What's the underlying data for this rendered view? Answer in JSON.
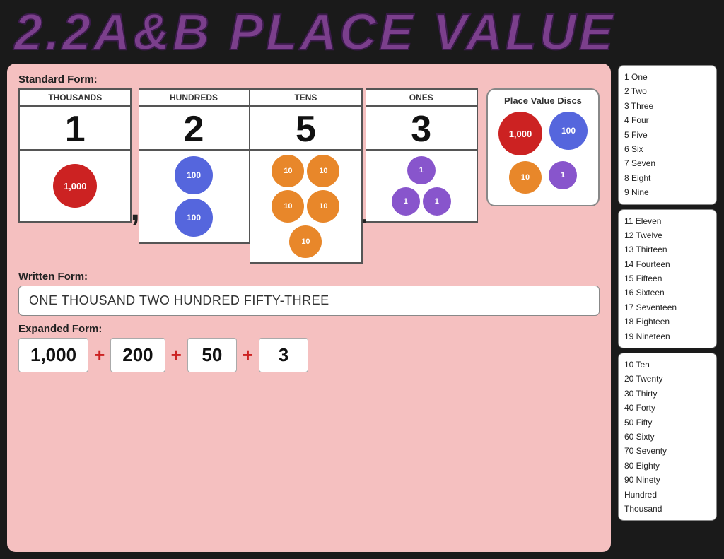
{
  "title": "2.2A&B  PLACE VALUE",
  "standard_form": {
    "label": "Standard Form:",
    "columns": [
      {
        "header": "THOUSANDS",
        "digit": "1"
      },
      {
        "header": "HUNDREDS",
        "digit": "2"
      },
      {
        "header": "TENS",
        "digit": "5"
      },
      {
        "header": "ONES",
        "digit": "3"
      }
    ]
  },
  "place_value_discs": {
    "title": "Place Value Discs",
    "row1": [
      "1,000",
      "100"
    ],
    "row2": [
      "10",
      "1"
    ]
  },
  "written_form": {
    "label": "Written Form:",
    "value": "ONE THOUSAND TWO HUNDRED FIFTY-THREE"
  },
  "expanded_form": {
    "label": "Expanded Form:",
    "parts": [
      "1,000",
      "200",
      "50",
      "3"
    ]
  },
  "ref_list_1": [
    "1  One",
    "2  Two",
    "3  Three",
    "4  Four",
    "5  Five",
    "6  Six",
    "7  Seven",
    "8  Eight",
    "9  Nine"
  ],
  "ref_list_2": [
    "11  Eleven",
    "12  Twelve",
    "13  Thirteen",
    "14  Fourteen",
    "15  Fifteen",
    "16  Sixteen",
    "17  Seventeen",
    "18  Eighteen",
    "19  Nineteen"
  ],
  "ref_list_3": [
    "10  Ten",
    "20  Twenty",
    "30  Thirty",
    "40  Forty",
    "50  Fifty",
    "60  Sixty",
    "70  Seventy",
    "80  Eighty",
    "90  Ninety",
    "Hundred",
    "Thousand"
  ]
}
